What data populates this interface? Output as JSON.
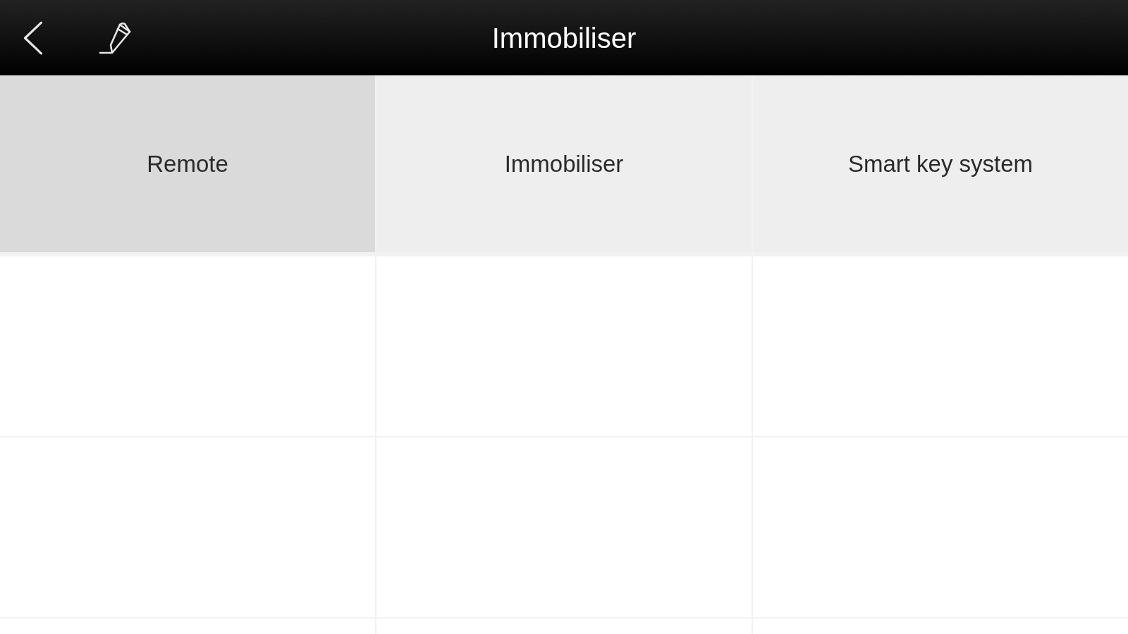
{
  "toolbar": {
    "title": "Immobiliser"
  },
  "menu": {
    "items": [
      {
        "label": "Remote",
        "selected": true
      },
      {
        "label": "Immobiliser",
        "selected": false
      },
      {
        "label": "Smart key system",
        "selected": false
      }
    ]
  }
}
